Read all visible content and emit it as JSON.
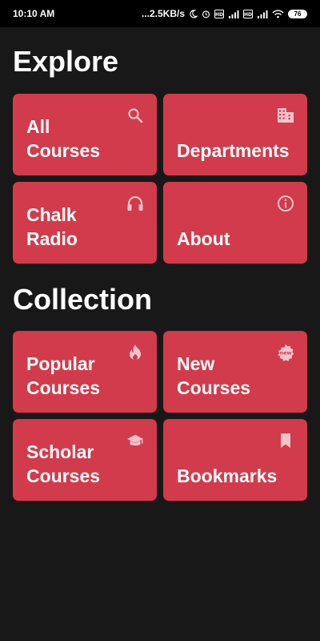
{
  "status_bar": {
    "time": "10:10 AM",
    "network_speed": "...2.5KB/s",
    "battery": "76"
  },
  "explore": {
    "title": "Explore",
    "tiles": [
      {
        "label": "All\nCourses",
        "icon": "search-icon"
      },
      {
        "label": "Departments",
        "icon": "building-icon"
      },
      {
        "label": "Chalk\nRadio",
        "icon": "headphones-icon"
      },
      {
        "label": "About",
        "icon": "info-icon"
      }
    ]
  },
  "collection": {
    "title": "Collection",
    "tiles": [
      {
        "label": "Popular\nCourses",
        "icon": "flame-icon"
      },
      {
        "label": "New\nCourses",
        "icon": "new-badge-icon",
        "badge_text": "new"
      },
      {
        "label": "Scholar\nCourses",
        "icon": "graduation-cap-icon"
      },
      {
        "label": "Bookmarks",
        "icon": "bookmark-icon"
      }
    ]
  },
  "colors": {
    "background": "#181818",
    "tile": "#d13b4b",
    "status_bar": "#000000",
    "icon": "#f2c4c9"
  }
}
